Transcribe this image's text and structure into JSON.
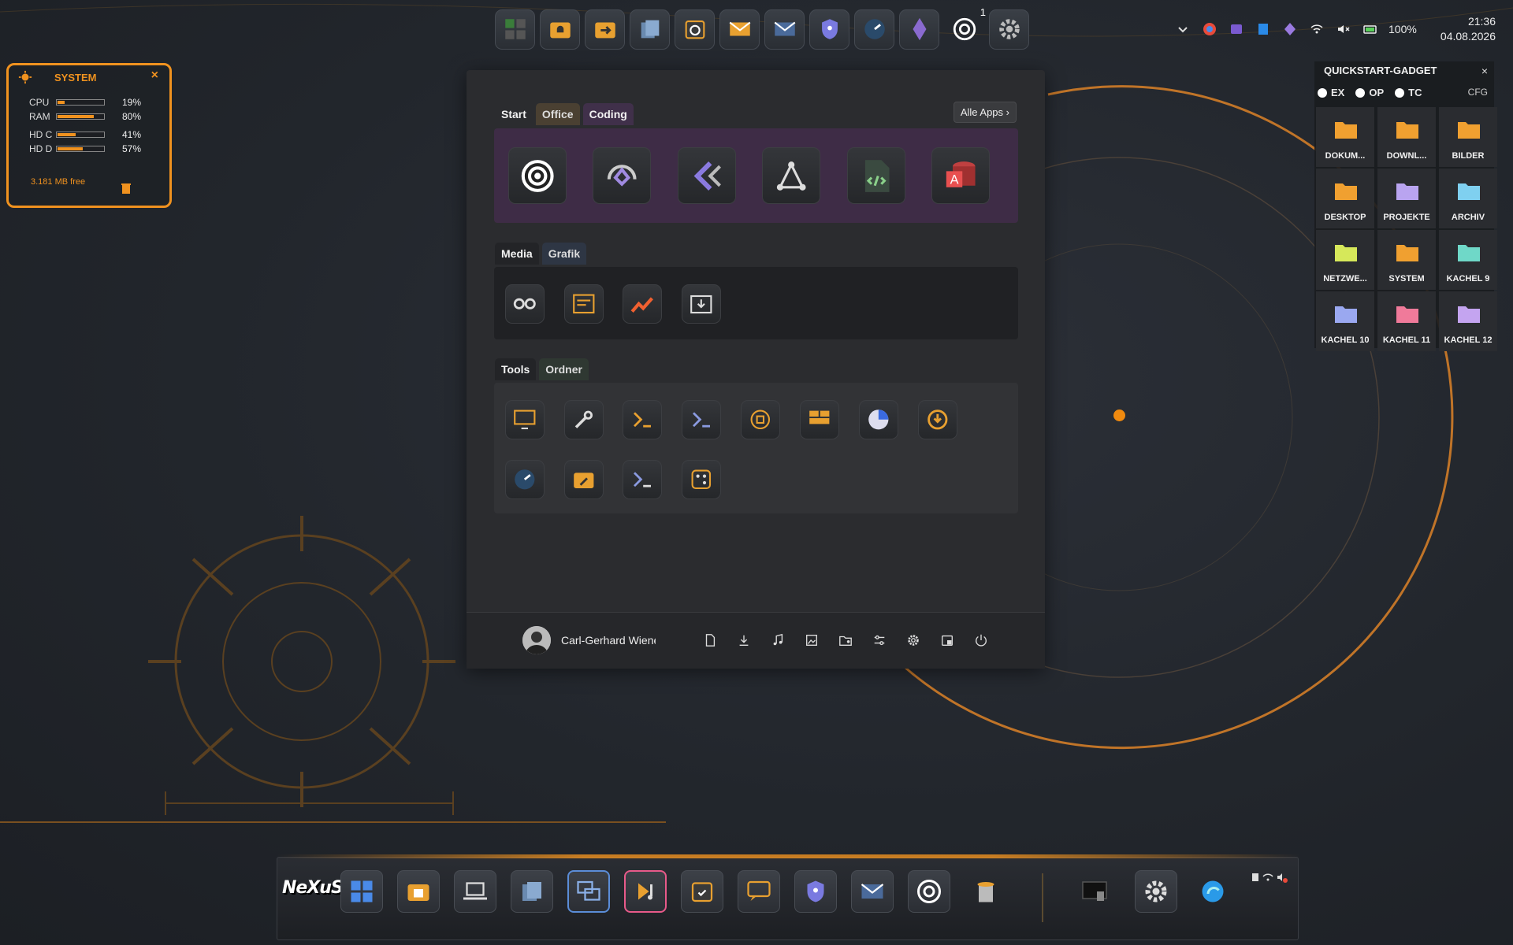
{
  "top_dock": {
    "items": [
      "start-grid-icon",
      "notification-folder-icon",
      "folder-arrow-icon",
      "files-icon",
      "security-check-icon",
      "mail-icon",
      "mail-dark-icon",
      "shield-key-icon",
      "speed-gauge-icon",
      "crystal-icon",
      "chatgpt-icon",
      "settings-gear-icon"
    ],
    "badge": "1"
  },
  "tray": {
    "battery": "100%",
    "time": "21:36",
    "date": "04.08.2026"
  },
  "system_widget": {
    "title": "SYSTEM",
    "close": "×",
    "rows": [
      {
        "label": "CPU",
        "value": "19%",
        "level": 0.19
      },
      {
        "label": "RAM",
        "value": "80%",
        "level": 0.8
      },
      {
        "label": "HD C",
        "value": "41%",
        "level": 0.41
      },
      {
        "label": "HD D",
        "value": "57%",
        "level": 0.57
      }
    ],
    "free": "3.181 MB free",
    "accent": "#f0921f"
  },
  "start_menu": {
    "tabs_top": [
      "Start",
      "Office",
      "Coding"
    ],
    "all_apps": "Alle Apps",
    "all_apps_chevron": "›",
    "coding_apps": [
      "chatgpt-icon",
      "windsurf-icon",
      "kilo-code-icon",
      "git-graph-icon",
      "html-file-icon",
      "access-db-icon"
    ],
    "tabs_media": [
      "Media",
      "Grafik"
    ],
    "media_apps": [
      "recorder-icon",
      "task-list-icon",
      "chart-app-icon",
      "download-box-icon"
    ],
    "tabs_tools": [
      "Tools",
      "Ordner"
    ],
    "tools_apps": [
      "monitor-icon",
      "wrench-icon",
      "terminal-orange-icon",
      "terminal-blue-icon",
      "rotate-box-icon",
      "layout-monitor-icon",
      "pie-gauge-icon",
      "restore-icon",
      "speed-gauge-icon",
      "folder-tool-icon",
      "terminal-icon",
      "dice-icon"
    ],
    "user_name": "Carl-Gerhard Wiene",
    "footer_icons": [
      "document-icon",
      "download-icon",
      "music-icon",
      "image-icon",
      "folder-user-icon",
      "sliders-icon",
      "gear-icon",
      "windows-file-icon",
      "power-icon"
    ]
  },
  "quickstart": {
    "title": "QUICKSTART-GADGET",
    "close": "×",
    "radios": [
      "EX",
      "OP",
      "TC"
    ],
    "cfg": "CFG",
    "tiles": [
      {
        "label": "DOKUM...",
        "icon": "documents-folder-icon",
        "color": "#f0a030"
      },
      {
        "label": "DOWNL...",
        "icon": "download-icon",
        "color": "#f0a030"
      },
      {
        "label": "BILDER",
        "icon": "pictures-folder-icon",
        "color": "#f0a030"
      },
      {
        "label": "DESKTOP",
        "icon": "desktop-icon",
        "color": "#f0a030"
      },
      {
        "label": "PROJEKTE",
        "icon": "folder-icon",
        "color": "#b9a4f0"
      },
      {
        "label": "ARCHIV",
        "icon": "folder-icon",
        "color": "#7fd0f0"
      },
      {
        "label": "NETZWE...",
        "icon": "folder-icon",
        "color": "#d6e85a"
      },
      {
        "label": "SYSTEM",
        "icon": "system-icon",
        "color": "#f0a030"
      },
      {
        "label": "KACHEL 9",
        "icon": "folder-icon",
        "color": "#6fd8c8"
      },
      {
        "label": "KACHEL 10",
        "icon": "folder-icon",
        "color": "#9aa8f0"
      },
      {
        "label": "KACHEL 11",
        "icon": "folder-icon",
        "color": "#f07a9a"
      },
      {
        "label": "KACHEL 12",
        "icon": "folder-icon",
        "color": "#c4a4f0"
      }
    ]
  },
  "taskbar": {
    "logo": "NeXuS",
    "items": [
      "start-grid-icon",
      "file-explorer-icon",
      "laptop-icon",
      "files-icon",
      "remote-desktop-icon",
      "media-player-icon",
      "security-check-icon",
      "chat-icon",
      "shield-key-icon",
      "mail-icon",
      "chatgpt-icon",
      "trash-icon"
    ],
    "right_items": [
      "window-preview-icon",
      "settings-gear-icon",
      "edge-icon",
      "tray-status-icon"
    ]
  }
}
